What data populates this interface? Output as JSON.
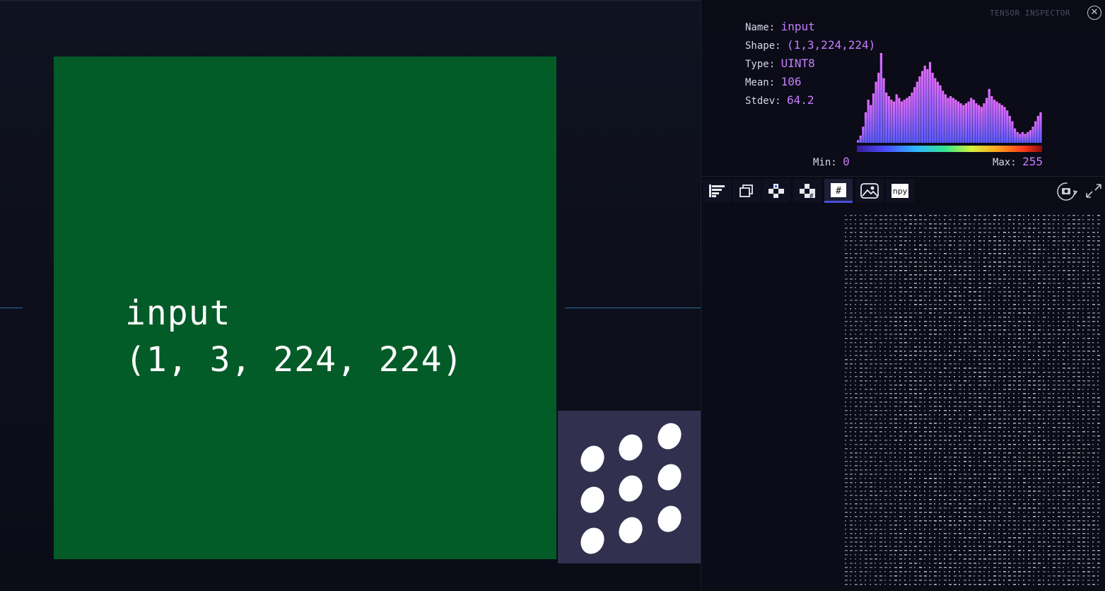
{
  "graph": {
    "node": {
      "title": "input\n(1, 3, 224, 224)",
      "color": "#035c28"
    },
    "dice_thumbnail": {
      "icon": "dice-nine-dots-icon",
      "color": "#32304f"
    },
    "edge_color": "#2d6e9e"
  },
  "inspector": {
    "title": "TENSOR INSPECTOR",
    "close_icon": "close-circle-icon",
    "stats": {
      "name_label": "Name:",
      "name_value": "input",
      "shape_label": "Shape:",
      "shape_value": "(1,3,224,224)",
      "type_label": "Type:",
      "type_value": "UINT8",
      "mean_label": "Mean:",
      "mean_value": "106",
      "stdev_label": "Stdev:",
      "stdev_value": "64.2",
      "min_label": "Min:",
      "min_value": "0",
      "max_label": "Max:",
      "max_value": "255"
    },
    "accent_color": "#c77dff",
    "histogram_values": [
      3,
      8,
      18,
      34,
      48,
      42,
      55,
      68,
      78,
      100,
      72,
      56,
      52,
      48,
      46,
      54,
      50,
      46,
      48,
      50,
      52,
      56,
      62,
      68,
      74,
      80,
      86,
      82,
      90,
      78,
      72,
      68,
      64,
      58,
      54,
      50,
      52,
      50,
      48,
      46,
      44,
      42,
      44,
      46,
      50,
      48,
      44,
      42,
      40,
      44,
      50,
      60,
      52,
      48,
      46,
      44,
      42,
      40,
      36,
      30,
      24,
      16,
      12,
      10,
      12,
      10,
      12,
      14,
      18,
      24,
      30,
      34
    ]
  },
  "toolbar": {
    "tools": [
      {
        "id": "stats",
        "icon": "bar-list-icon",
        "label": ""
      },
      {
        "id": "layers",
        "icon": "stacked-squares-icon",
        "label": ""
      },
      {
        "id": "checker",
        "icon": "checkerboard-icon",
        "label": ""
      },
      {
        "id": "checker-hash",
        "icon": "checkerboard-hash-icon",
        "label": ""
      },
      {
        "id": "values",
        "icon": "hash-icon",
        "label": "#"
      },
      {
        "id": "image",
        "icon": "image-icon",
        "label": ""
      },
      {
        "id": "npy",
        "icon": "npy-export-icon",
        "label": "npy"
      }
    ],
    "active": "values",
    "rotate_icon": "rotate-camera-icon",
    "expand_icon": "expand-icon"
  }
}
